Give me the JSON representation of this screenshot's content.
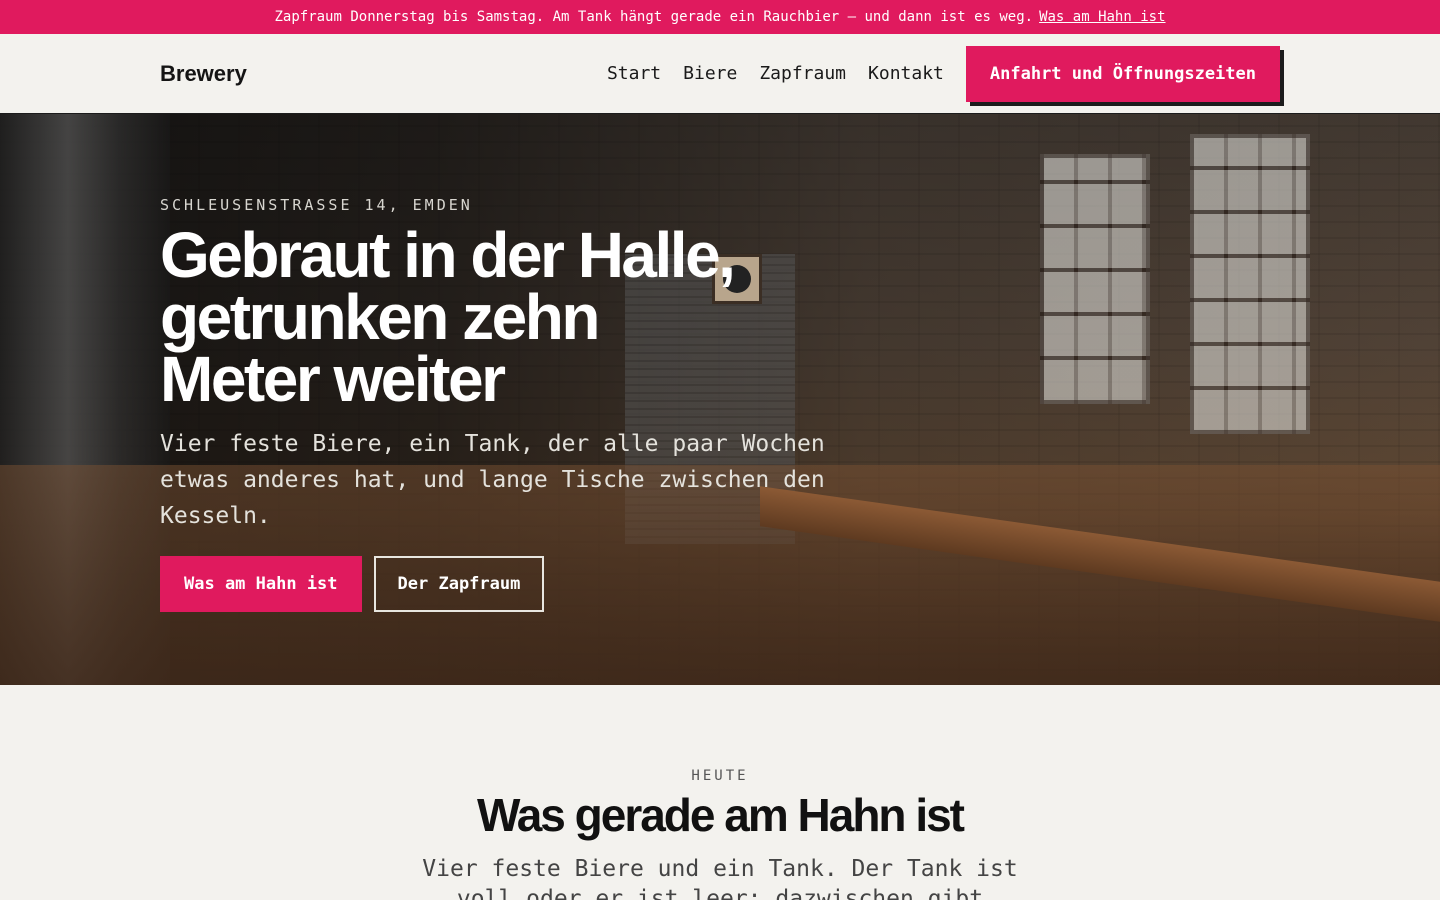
{
  "announcement": {
    "text": "Zapfraum Donnerstag bis Samstag. Am Tank hängt gerade ein Rauchbier — und dann ist es weg.",
    "link": "Was am Hahn ist"
  },
  "nav": {
    "brand": "Brewery",
    "links": [
      "Start",
      "Biere",
      "Zapfraum",
      "Kontakt"
    ],
    "cta": "Anfahrt und Öffnungszeiten"
  },
  "hero": {
    "eyebrow": "SCHLEUSENSTRASSE 14, EMDEN",
    "title": "Gebraut in der Halle, getrunken zehn Meter weiter",
    "subtitle": "Vier feste Biere, ein Tank, der alle paar Wochen etwas anderes hat, und lange Tische zwischen den Kesseln.",
    "primary_button": "Was am Hahn ist",
    "secondary_button": "Der Zapfraum"
  },
  "section": {
    "eyebrow": "HEUTE",
    "title": "Was gerade am Hahn ist",
    "subtitle": "Vier feste Biere und ein Tank. Der Tank ist voll oder er ist leer; dazwischen gibt"
  },
  "colors": {
    "accent": "#e01a5e",
    "background": "#f3f2ee",
    "text": "#141414"
  }
}
